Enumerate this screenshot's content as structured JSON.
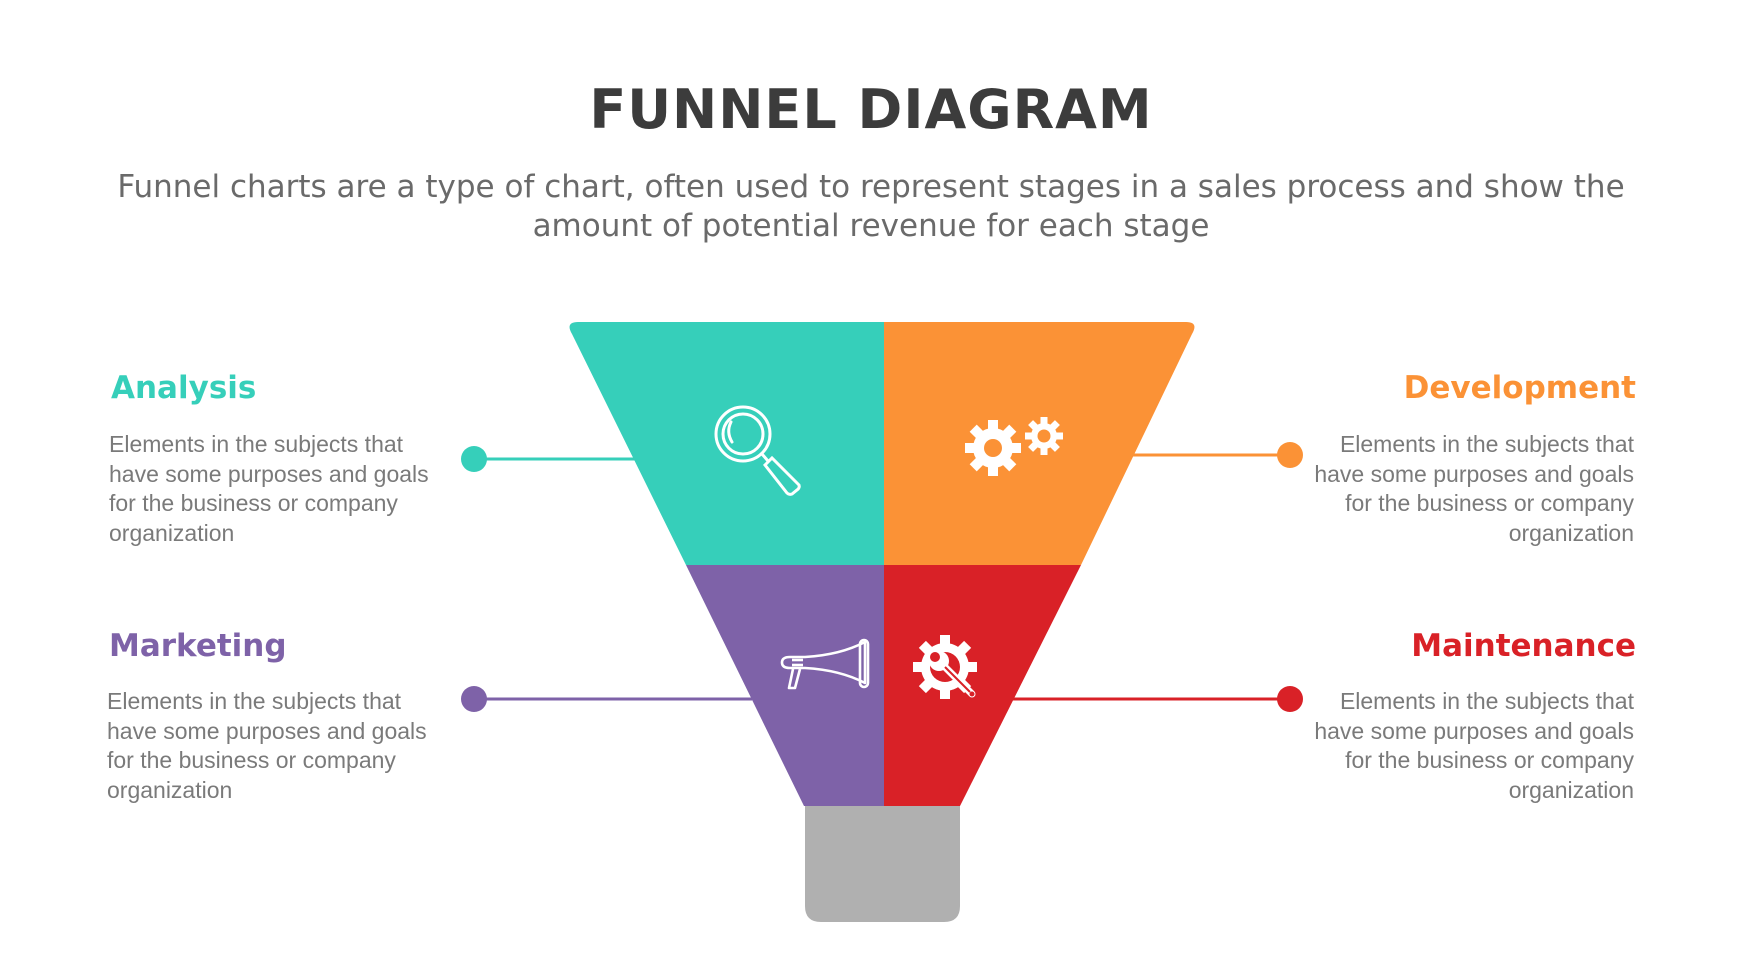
{
  "header": {
    "title": "FUNNEL DIAGRAM",
    "subtitle": "Funnel charts are a type of chart, often used to represent stages in a sales process and show the amount of potential revenue for each stage"
  },
  "stages": [
    {
      "id": "analysis",
      "title": "Analysis",
      "description": "Elements in the subjects that have some purposes and goals for the  business or company organization",
      "color": "#36cfba",
      "icon": "magnifier-icon",
      "side": "left",
      "position": "top"
    },
    {
      "id": "development",
      "title": "Development",
      "description": "Elements in the subjects that have some purposes and goals for the  business or company organization",
      "color": "#fb9236",
      "icon": "gears-icon",
      "side": "right",
      "position": "top"
    },
    {
      "id": "marketing",
      "title": "Marketing",
      "description": "Elements in the subjects that have some purposes and goals for the  business or company organization",
      "color": "#7e62a8",
      "icon": "megaphone-icon",
      "side": "left",
      "position": "bottom"
    },
    {
      "id": "maintenance",
      "title": "Maintenance",
      "description": "Elements in the subjects that have some purposes and goals for the  business or company organization",
      "color": "#d92127",
      "icon": "gear-wrench-icon",
      "side": "right",
      "position": "bottom"
    }
  ],
  "funnel_stem_color": "#b0b0b0",
  "text_colors": {
    "title": "#3c3c3c",
    "body": "#7a7a7a"
  }
}
